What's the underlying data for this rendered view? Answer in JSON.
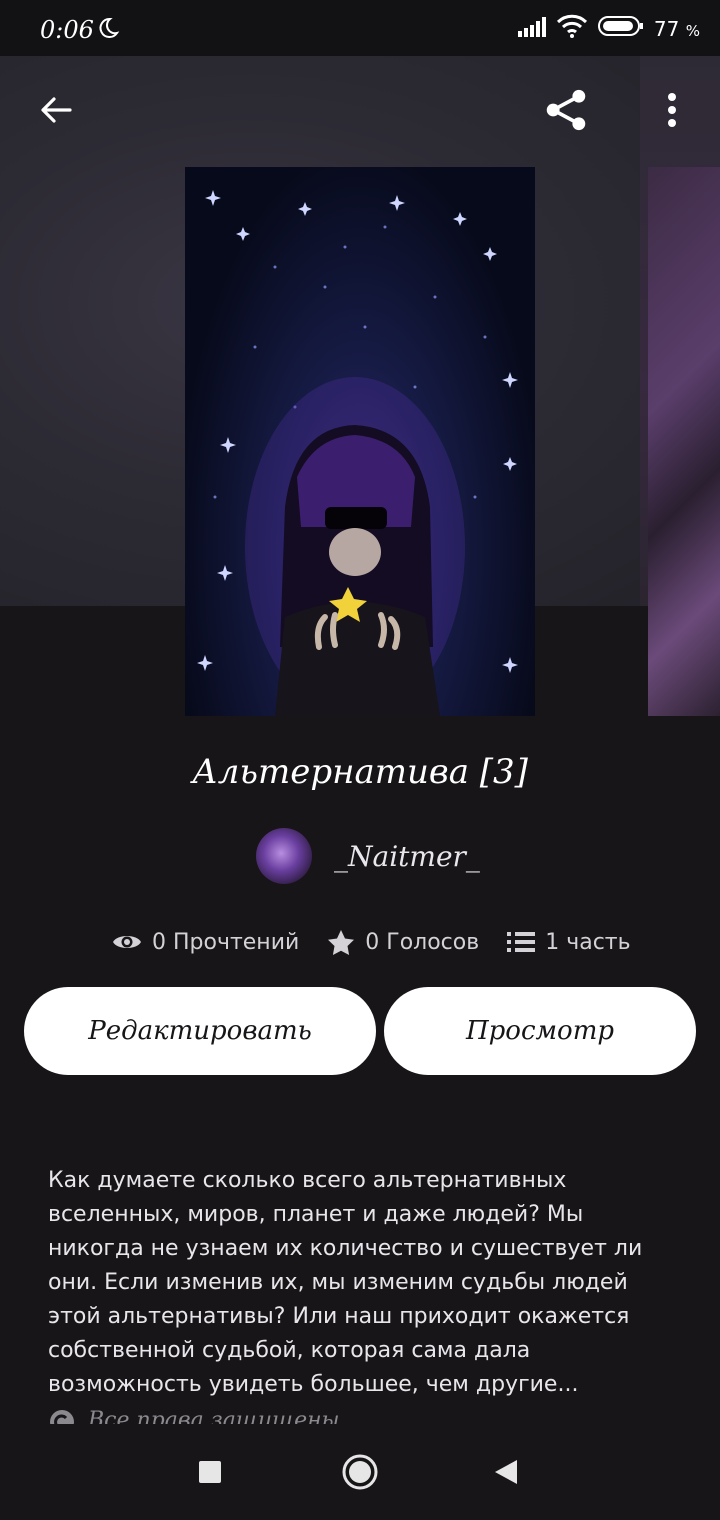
{
  "status_bar": {
    "time": "0:06",
    "battery_percent": "77",
    "percent_sign": "%"
  },
  "toolbar": {
    "back_icon": "arrow-left-icon",
    "share_icon": "share-icon",
    "menu_icon": "more-vert-icon"
  },
  "story": {
    "title": "Альтернатива [3]",
    "author": "_Naitmer_",
    "stats": {
      "reads": "0 Прочтений",
      "votes": "0 Голосов",
      "parts": "1 часть"
    },
    "description": "Как думаете сколько всего альтернативных вселенных, миров, планет и даже людей? Мы никогда не узнаем их количество и сушествует ли они. Если изменив их, мы изменим судьбы людей этой альтернативы? Или наш приходит окажется собственной судьбой, которая сама дала возможность увидеть большее, чем другие...",
    "copyright": "Все права защищены"
  },
  "actions": {
    "edit_label": "Редактировать",
    "preview_label": "Просмотр"
  },
  "colors": {
    "background": "#171518",
    "button_bg": "#ffffff",
    "text": "#ffffff"
  }
}
